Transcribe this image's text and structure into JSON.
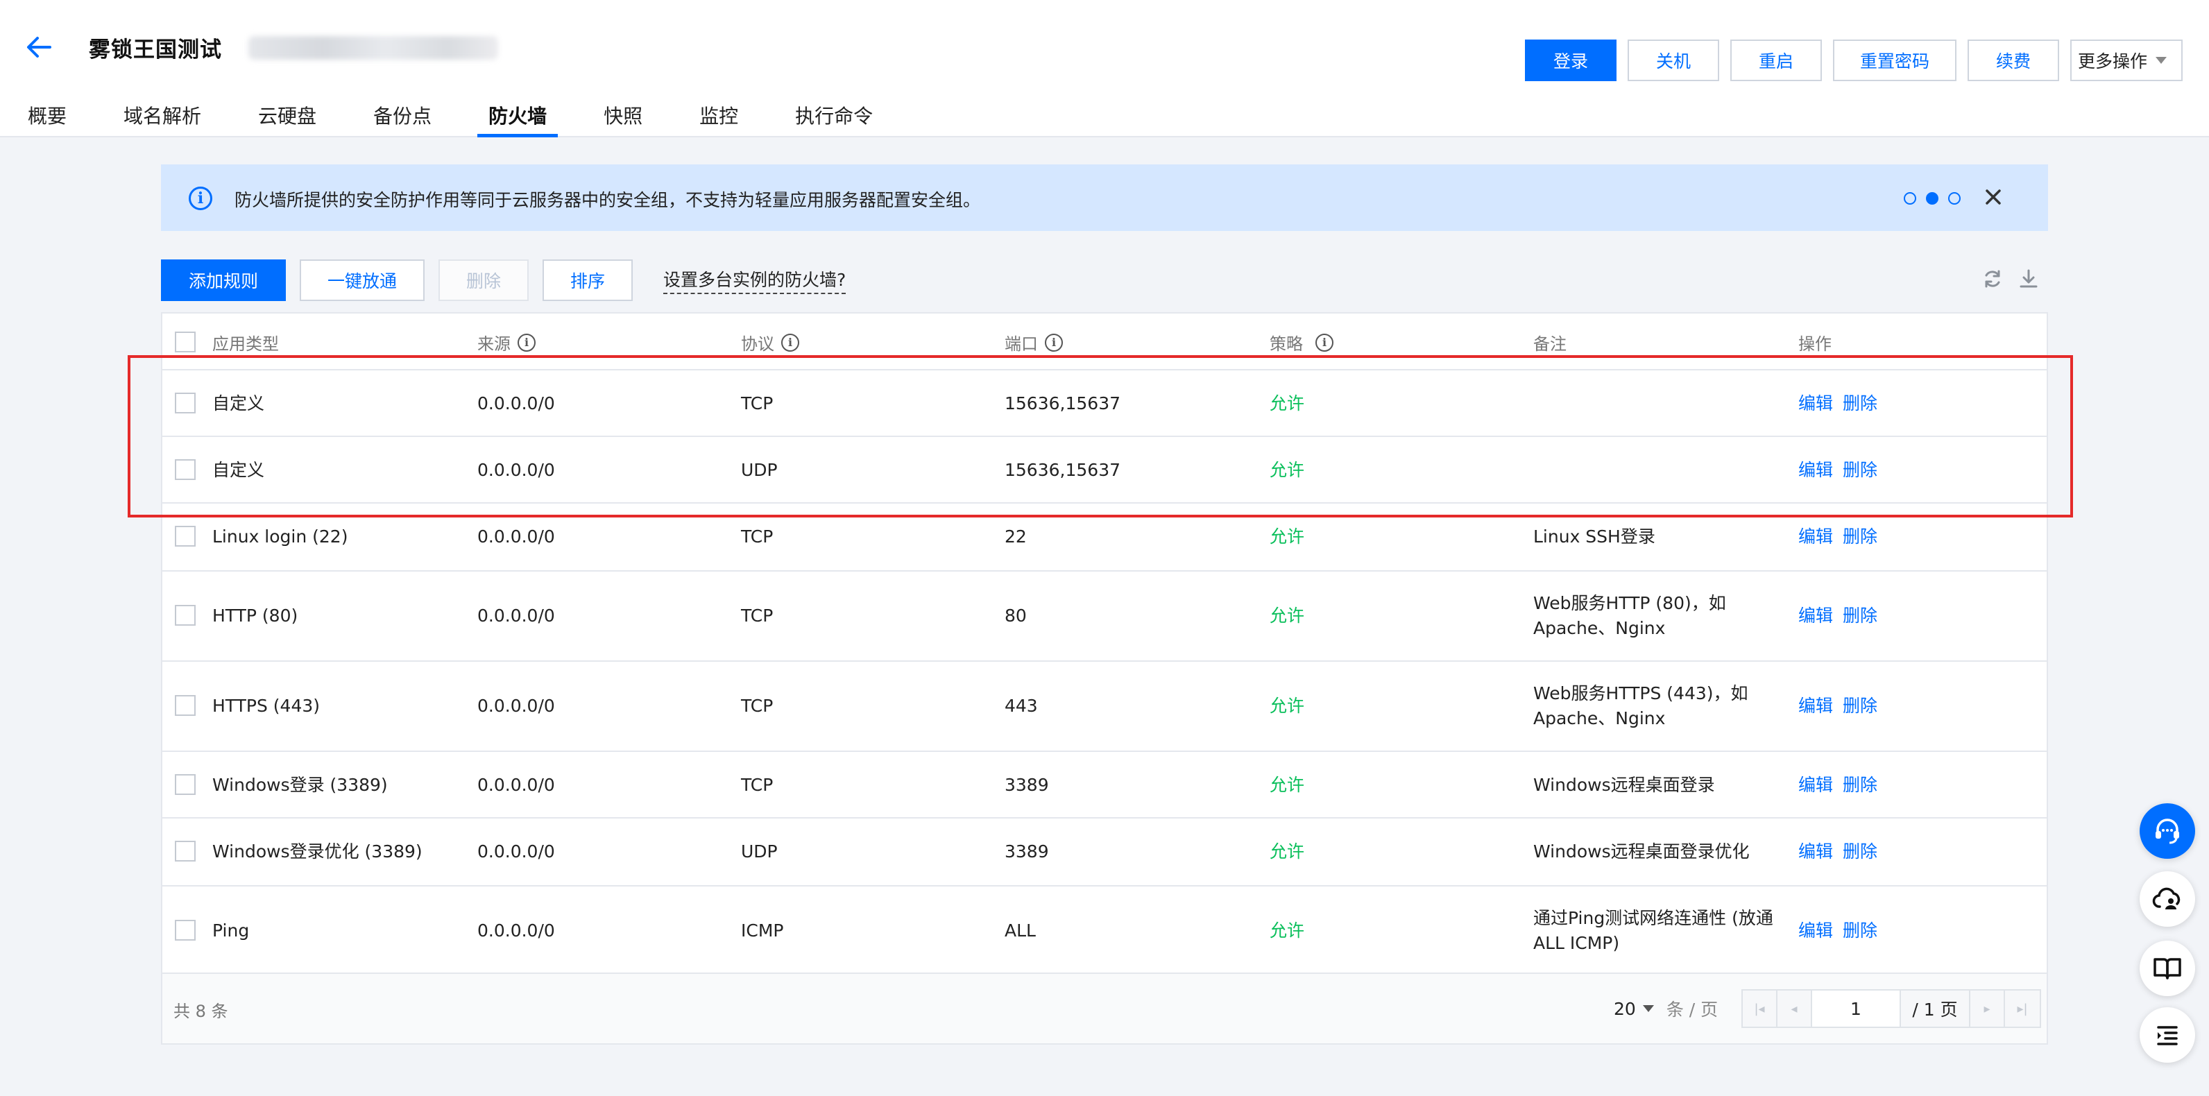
{
  "header": {
    "title": "雾锁王国测试",
    "actions": {
      "login": "登录",
      "shutdown": "关机",
      "restart": "重启",
      "reset_password": "重置密码",
      "renew": "续费",
      "more": "更多操作"
    },
    "tabs": [
      "概要",
      "域名解析",
      "云硬盘",
      "备份点",
      "防火墙",
      "快照",
      "监控",
      "执行命令"
    ],
    "active_tab": "防火墙"
  },
  "notice": {
    "text": "防火墙所提供的安全防护作用等同于云服务器中的安全组，不支持为轻量应用服务器配置安全组。",
    "carousel_active": 2
  },
  "toolbar": {
    "add_rule": "添加规则",
    "allow_all": "一键放通",
    "delete": "删除",
    "sort": "排序",
    "multi_instance_link": "设置多台实例的防火墙?"
  },
  "table": {
    "columns": {
      "type": "应用类型",
      "source": "来源",
      "protocol": "协议",
      "port": "端口",
      "policy": "策略",
      "note": "备注",
      "ops": "操作"
    },
    "rows": [
      {
        "type": "自定义",
        "source": "0.0.0.0/0",
        "protocol": "TCP",
        "port": "15636,15637",
        "policy": "允许",
        "note": ""
      },
      {
        "type": "自定义",
        "source": "0.0.0.0/0",
        "protocol": "UDP",
        "port": "15636,15637",
        "policy": "允许",
        "note": ""
      },
      {
        "type": "Linux login (22)",
        "source": "0.0.0.0/0",
        "protocol": "TCP",
        "port": "22",
        "policy": "允许",
        "note": "Linux SSH登录"
      },
      {
        "type": "HTTP (80)",
        "source": "0.0.0.0/0",
        "protocol": "TCP",
        "port": "80",
        "policy": "允许",
        "note": "Web服务HTTP (80)，如 Apache、Nginx"
      },
      {
        "type": "HTTPS (443)",
        "source": "0.0.0.0/0",
        "protocol": "TCP",
        "port": "443",
        "policy": "允许",
        "note": "Web服务HTTPS (443)，如 Apache、Nginx"
      },
      {
        "type": "Windows登录 (3389)",
        "source": "0.0.0.0/0",
        "protocol": "TCP",
        "port": "3389",
        "policy": "允许",
        "note": "Windows远程桌面登录"
      },
      {
        "type": "Windows登录优化 (3389)",
        "source": "0.0.0.0/0",
        "protocol": "UDP",
        "port": "3389",
        "policy": "允许",
        "note": "Windows远程桌面登录优化"
      },
      {
        "type": "Ping",
        "source": "0.0.0.0/0",
        "protocol": "ICMP",
        "port": "ALL",
        "policy": "允许",
        "note": "通过Ping测试网络连通性 (放通 ALL ICMP)"
      }
    ],
    "row_ops": {
      "edit": "编辑",
      "delete": "删除"
    },
    "footer": {
      "total": "共 8 条",
      "page_size": "20",
      "page_size_unit": "条 / 页",
      "current_page": "1",
      "total_pages": "/ 1 页"
    }
  },
  "colors": {
    "primary": "#006eff",
    "allow": "#0abf5b",
    "highlight": "#e52a2a",
    "notice_bg": "#d5e7ff"
  },
  "icons": [
    "back-arrow-icon",
    "info-icon",
    "close-icon",
    "refresh-icon",
    "download-icon",
    "headset-icon",
    "cloud-user-icon",
    "book-icon",
    "list-icon"
  ]
}
